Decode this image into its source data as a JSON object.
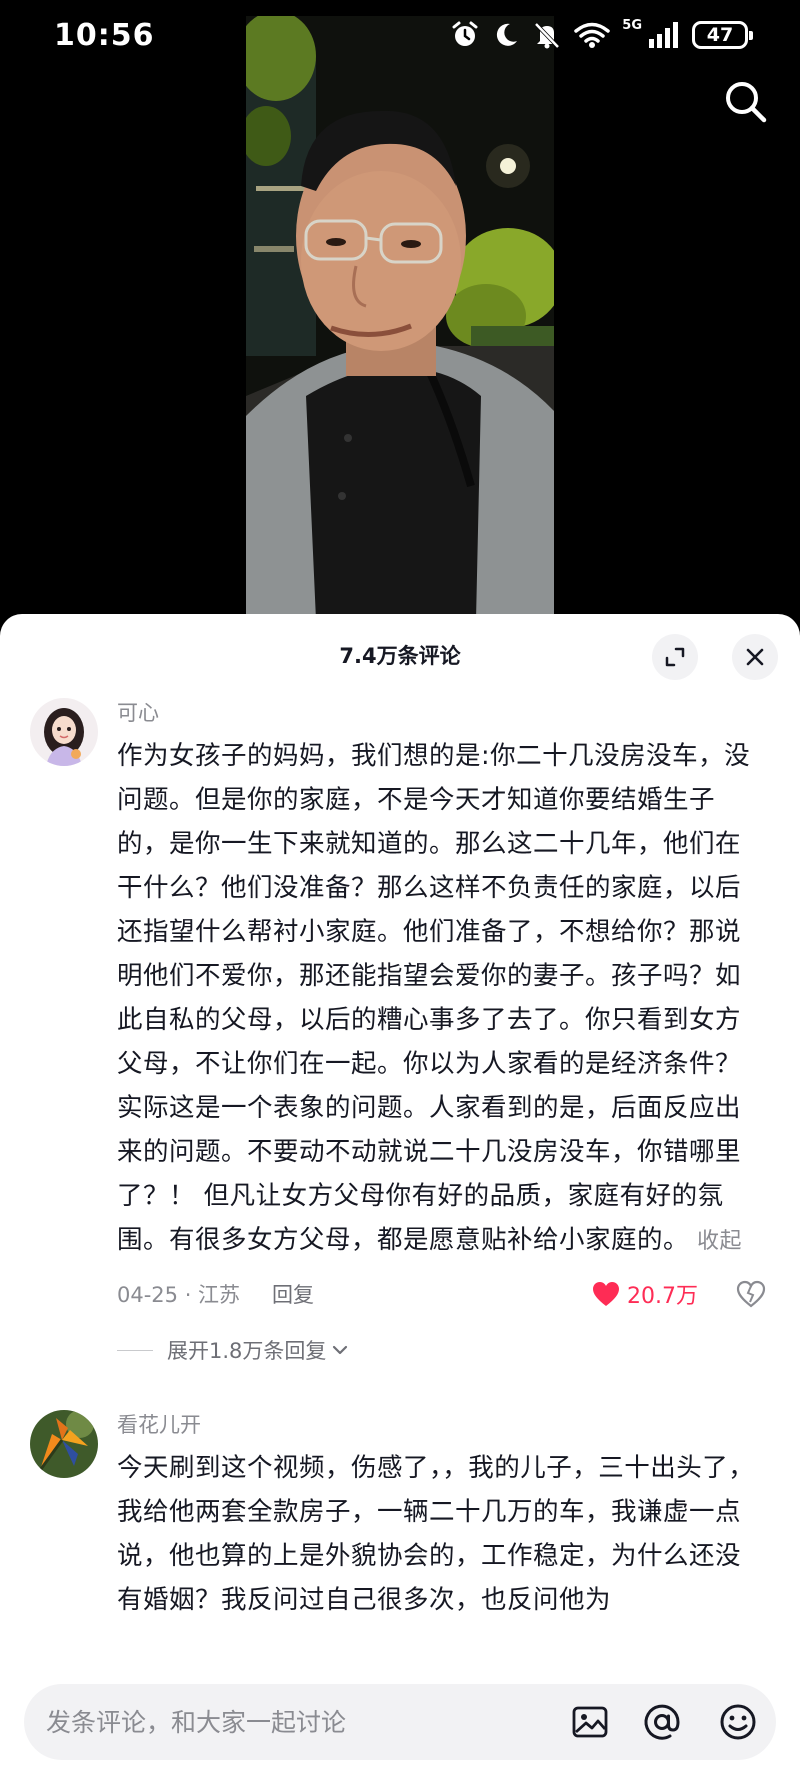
{
  "status_bar": {
    "time": "10:56",
    "network": "5G",
    "battery": "47"
  },
  "sheet": {
    "title": "7.4万条评论"
  },
  "comments": [
    {
      "username": "可心",
      "text": "作为女孩子的妈妈，我们想的是:你二十几没房没车，没问题。但是你的家庭，不是今天才知道你要结婚生子的，是你一生下来就知道的。那么这二十几年，他们在干什么？他们没准备？那么这样不负责任的家庭，以后还指望什么帮衬小家庭。他们准备了，不想给你？那说明他们不爱你，那还能指望会爱你的妻子。孩子吗？如此自私的父母，以后的糟心事多了去了。你只看到女方父母，不让你们在一起。你以为人家看的是经济条件？实际这是一个表象的问题。人家看到的是，后面反应出来的问题。不要动不动就说二十几没房没车，你错哪里了？！ 但凡让女方父母你有好的品质，家庭有好的氛围。有很多女方父母，都是愿意贴补给小家庭的。",
      "collapse_label": "收起",
      "meta": "04-25 · 江苏",
      "reply_label": "回复",
      "likes": "20.7万",
      "expand_replies": "展开1.8万条回复"
    },
    {
      "username": "看花儿开",
      "text": "今天刷到这个视频，伤感了，，我的儿子，三十出头了，我给他两套全款房子，一辆二十几万的车，我谦虚一点说，他也算的上是外貌协会的，工作稳定，为什么还没有婚姻？我反问过自己很多次，也反问他为"
    }
  ],
  "input": {
    "placeholder": "发条评论，和大家一起讨论"
  },
  "colors": {
    "like": "#fe2c55",
    "muted_text": "#8a8b91",
    "primary_text": "#161823"
  }
}
